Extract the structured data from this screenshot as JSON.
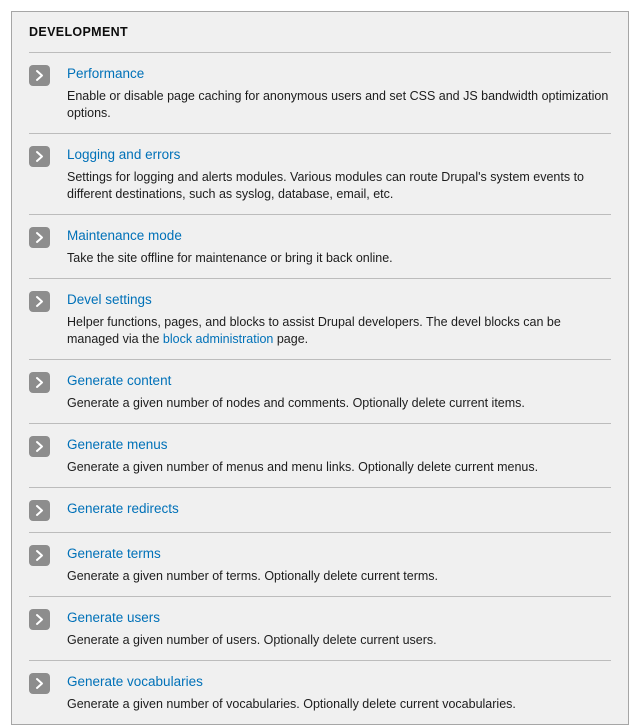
{
  "page": {
    "section_title": "DEVELOPMENT",
    "chevron_icon_name": "chevron-right-icon",
    "colors": {
      "link": "#0071b8",
      "panel_background": "#f0f0f0",
      "panel_border": "#a6a6a6",
      "divider": "#bcbcbc",
      "icon_background": "#8d8d8d",
      "text": "#1c1c1c"
    }
  },
  "items": [
    {
      "title": "Performance",
      "description": "Enable or disable page caching for anonymous users and set CSS and JS bandwidth optimization options."
    },
    {
      "title": "Logging and errors",
      "description": "Settings for logging and alerts modules. Various modules can route Drupal's system events to different destinations, such as syslog, database, email, etc."
    },
    {
      "title": "Maintenance mode",
      "description": "Take the site offline for maintenance or bring it back online."
    },
    {
      "title": "Devel settings",
      "description_before": "Helper functions, pages, and blocks to assist Drupal developers. The devel blocks can be managed via the ",
      "description_link": "block administration",
      "description_after": " page."
    },
    {
      "title": "Generate content",
      "description": "Generate a given number of nodes and comments. Optionally delete current items."
    },
    {
      "title": "Generate menus",
      "description": "Generate a given number of menus and menu links. Optionally delete current menus."
    },
    {
      "title": "Generate redirects",
      "description": ""
    },
    {
      "title": "Generate terms",
      "description": "Generate a given number of terms. Optionally delete current terms."
    },
    {
      "title": "Generate users",
      "description": "Generate a given number of users. Optionally delete current users."
    },
    {
      "title": "Generate vocabularies",
      "description": "Generate a given number of vocabularies. Optionally delete current vocabularies."
    }
  ]
}
